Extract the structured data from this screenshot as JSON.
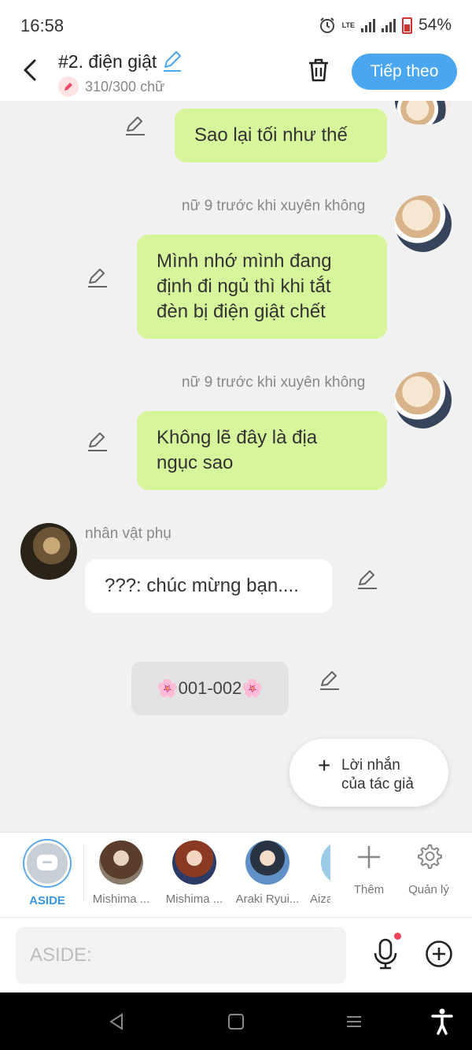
{
  "status": {
    "time": "16:58",
    "battery": "54%",
    "network": "LTE"
  },
  "header": {
    "title": "#2. điện giật",
    "word_count": "310/300 chữ",
    "next_label": "Tiếp theo"
  },
  "messages": [
    {
      "text": "Sao lại tối như thế"
    },
    {
      "name": "nữ 9 trước khi xuyên không",
      "text": "Mình nhớ mình đang định đi ngủ thì khi tắt đèn bị điện giật chết",
      "lines": [
        "Mình nhớ mình đang",
        "định đi ngủ thì khi tắt",
        "đèn bị điện giật chết"
      ]
    },
    {
      "name": "nữ 9 trước khi xuyên không",
      "text": "Không lẽ đây là địa ngục sao",
      "lines": [
        "Không lẽ đây là địa",
        "ngục sao"
      ]
    },
    {
      "name": "nhân vật phụ",
      "text": "???: chúc mừng bạn...."
    },
    {
      "text": "🌸001-002🌸"
    }
  ],
  "author_note": {
    "lines": [
      "Lời nhắn",
      "của tác giả"
    ]
  },
  "characters": [
    {
      "label": "ASIDE",
      "selected": true
    },
    {
      "label": "Mishima ..."
    },
    {
      "label": "Mishima ..."
    },
    {
      "label": "Araki Ryui..."
    },
    {
      "label": "Aiza"
    }
  ],
  "tools": {
    "add_label": "Thêm",
    "manage_label": "Quản lý"
  },
  "input": {
    "placeholder": "ASIDE:"
  },
  "colors": {
    "accent": "#4aa6ee",
    "bubble_green": "#d7f59a",
    "bubble_white": "#ffffff"
  }
}
